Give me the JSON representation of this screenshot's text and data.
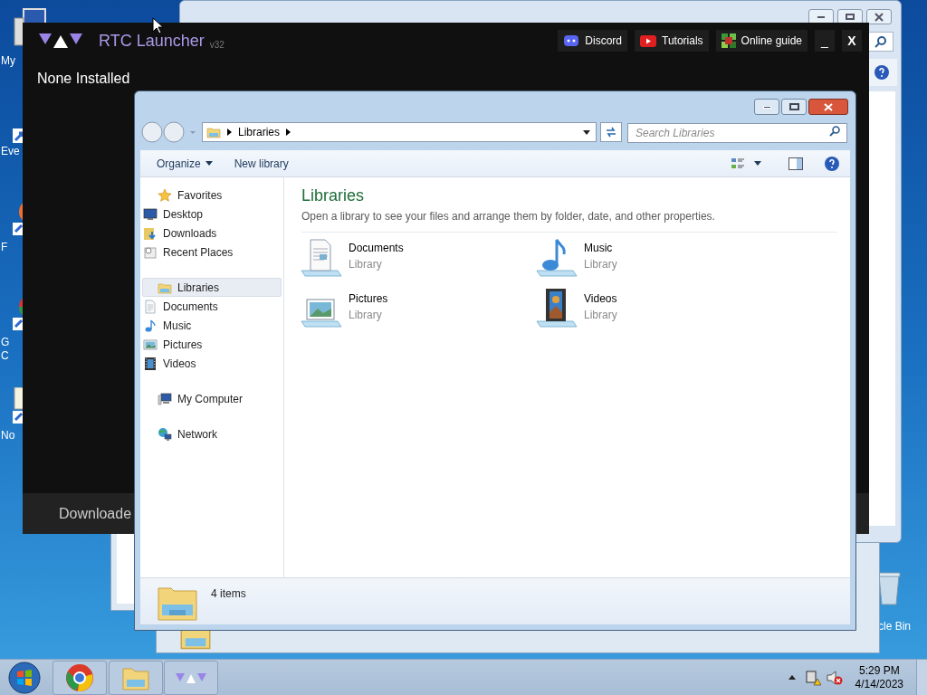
{
  "desktop_icons": [
    {
      "kind": "computer",
      "lines": [
        "My"
      ]
    },
    {
      "kind": "shortcut",
      "lines": [
        "Eve"
      ]
    },
    {
      "kind": "firefox",
      "lines": [
        "F"
      ]
    },
    {
      "kind": "chrome",
      "lines": [
        "G",
        "C"
      ]
    },
    {
      "kind": "notepad",
      "lines": [
        "No"
      ]
    }
  ],
  "recycle_bin": {
    "label": "cle Bin"
  },
  "launcher": {
    "title": "RTC Launcher",
    "version": "v32",
    "links": [
      {
        "kind": "discord",
        "label": "Discord"
      },
      {
        "kind": "youtube",
        "label": "Tutorials"
      },
      {
        "kind": "guide",
        "label": "Online guide"
      }
    ],
    "minimize": "_",
    "close": "X",
    "heading": "None Installed",
    "footer": "Downloade"
  },
  "explorer": {
    "breadcrumb": [
      "Libraries"
    ],
    "search": {
      "placeholder": "Search Libraries"
    },
    "toolbar": [
      {
        "label": "Organize",
        "dropdown": true
      },
      {
        "label": "New library",
        "dropdown": false
      }
    ],
    "nav": [
      {
        "kind": "star",
        "label": "Favorites",
        "selected": false,
        "children": [
          {
            "kind": "desktop",
            "label": "Desktop",
            "selected": false
          },
          {
            "kind": "downloads",
            "label": "Downloads",
            "selected": false
          },
          {
            "kind": "recent",
            "label": "Recent Places",
            "selected": false
          }
        ]
      },
      {
        "kind": "libraries",
        "label": "Libraries",
        "selected": true,
        "children": [
          {
            "kind": "documents",
            "label": "Documents",
            "selected": false
          },
          {
            "kind": "music",
            "label": "Music",
            "selected": false
          },
          {
            "kind": "pictures",
            "label": "Pictures",
            "selected": false
          },
          {
            "kind": "videos",
            "label": "Videos",
            "selected": false
          }
        ]
      },
      {
        "kind": "computer",
        "label": "My Computer",
        "selected": false
      },
      {
        "kind": "network",
        "label": "Network",
        "selected": false
      }
    ],
    "title": "Libraries",
    "description": "Open a library to see your files and arrange them by folder, date, and other properties.",
    "items": [
      {
        "kind": "documents",
        "name": "Documents",
        "type": "Library"
      },
      {
        "kind": "music",
        "name": "Music",
        "type": "Library"
      },
      {
        "kind": "pictures",
        "name": "Pictures",
        "type": "Library"
      },
      {
        "kind": "videos",
        "name": "Videos",
        "type": "Library"
      }
    ],
    "status": "4 items"
  },
  "taskbar": {
    "apps": [
      {
        "kind": "chrome"
      },
      {
        "kind": "explorer"
      },
      {
        "kind": "rtc"
      }
    ],
    "time": "5:29 PM",
    "date": "4/14/2023"
  }
}
